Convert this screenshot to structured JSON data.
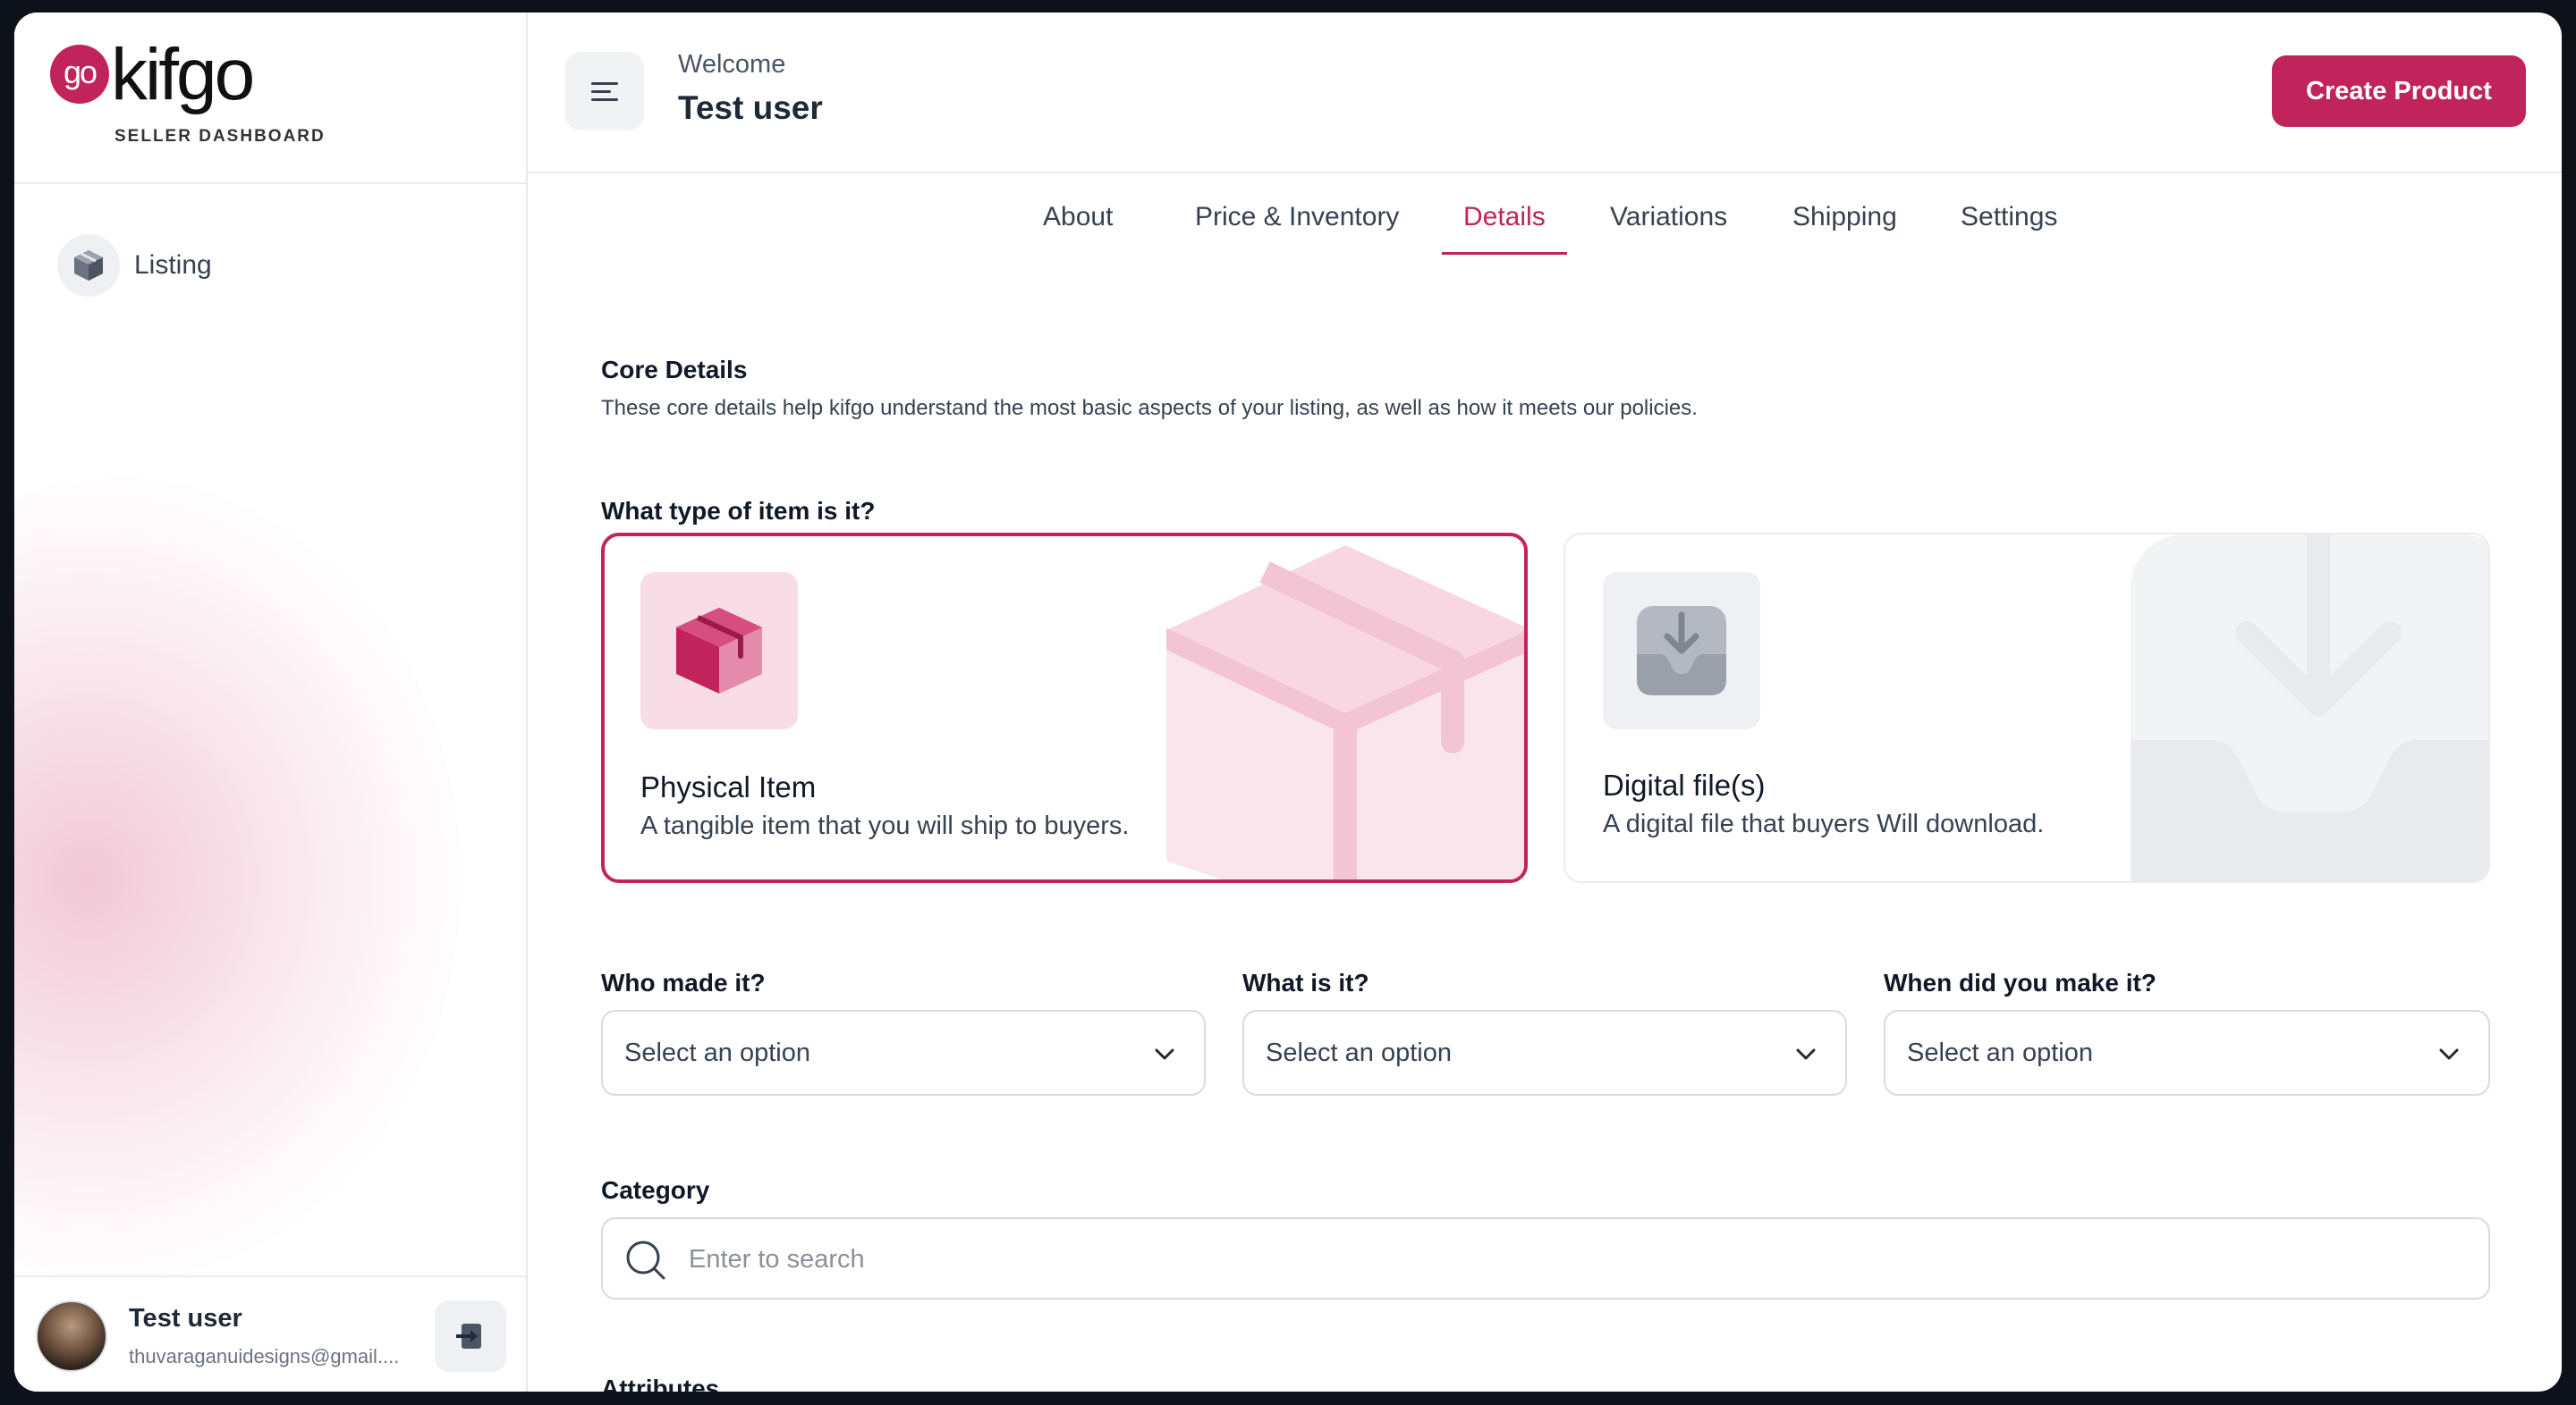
{
  "brand": {
    "badge": "go",
    "name": "kifgo",
    "subtitle": "SELLER DASHBOARD",
    "accent_color": "#c0245a"
  },
  "sidebar": {
    "items": [
      {
        "label": "Listing",
        "icon": "box-icon"
      }
    ],
    "user": {
      "name": "Test user",
      "email": "thuvaraganuidesigns@gmail...."
    }
  },
  "header": {
    "welcome": "Welcome",
    "user_name": "Test user",
    "create_button": "Create Product"
  },
  "tabs": [
    {
      "label": "About",
      "active": false
    },
    {
      "label": "Price & Inventory",
      "active": false
    },
    {
      "label": "Details",
      "active": true
    },
    {
      "label": "Variations",
      "active": false
    },
    {
      "label": "Shipping",
      "active": false
    },
    {
      "label": "Settings",
      "active": false
    }
  ],
  "details": {
    "core_title": "Core Details",
    "core_description": "These core details help kifgo understand the most basic aspects of your listing, as well as how it meets our policies.",
    "item_type_question": "What type of item is it?",
    "item_types": [
      {
        "title": "Physical Item",
        "description": "A tangible item that you will ship to buyers.",
        "selected": true
      },
      {
        "title": "Digital file(s)",
        "description": "A digital file that buyers Will download.",
        "selected": false
      }
    ],
    "selects": [
      {
        "label": "Who made it?",
        "value": "Select an option"
      },
      {
        "label": "What is it?",
        "value": "Select an option"
      },
      {
        "label": "When did you make it?",
        "value": "Select an option"
      }
    ],
    "category_label": "Category",
    "category_placeholder": "Enter to search",
    "attributes_label": "Attributes"
  }
}
